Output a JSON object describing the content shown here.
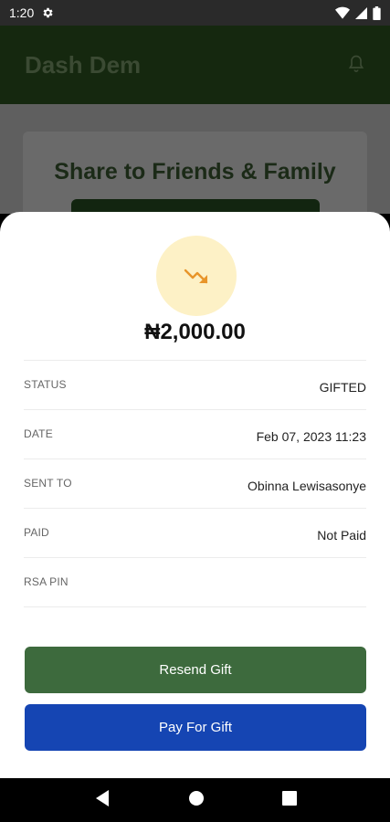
{
  "status_bar": {
    "time": "1:20",
    "icons": [
      "gear-icon",
      "wifi-icon",
      "signal-icon",
      "battery-icon"
    ]
  },
  "app_bar": {
    "title": "Dash Dem",
    "icon": "bell-icon"
  },
  "background_card": {
    "title": "Share to Friends & Family"
  },
  "sheet": {
    "icon": "trending-down-icon",
    "amount": "₦2,000.00",
    "rows": [
      {
        "label": "STATUS",
        "value": "GIFTED"
      },
      {
        "label": "DATE",
        "value": "Feb 07, 2023 11:23"
      },
      {
        "label": "SENT TO",
        "value": "Obinna Lewisasonye"
      },
      {
        "label": "PAID",
        "value": "Not Paid"
      },
      {
        "label": "RSA PIN",
        "value": ""
      }
    ],
    "resend_label": "Resend Gift",
    "pay_label": "Pay For Gift"
  },
  "nav_bar": {
    "icons": [
      "back-icon",
      "home-icon",
      "recents-icon"
    ]
  },
  "colors": {
    "resend": "#3d6a3d",
    "pay": "#1545b3",
    "icon_bg": "#fdf1c6",
    "icon_fg": "#e8952a"
  }
}
